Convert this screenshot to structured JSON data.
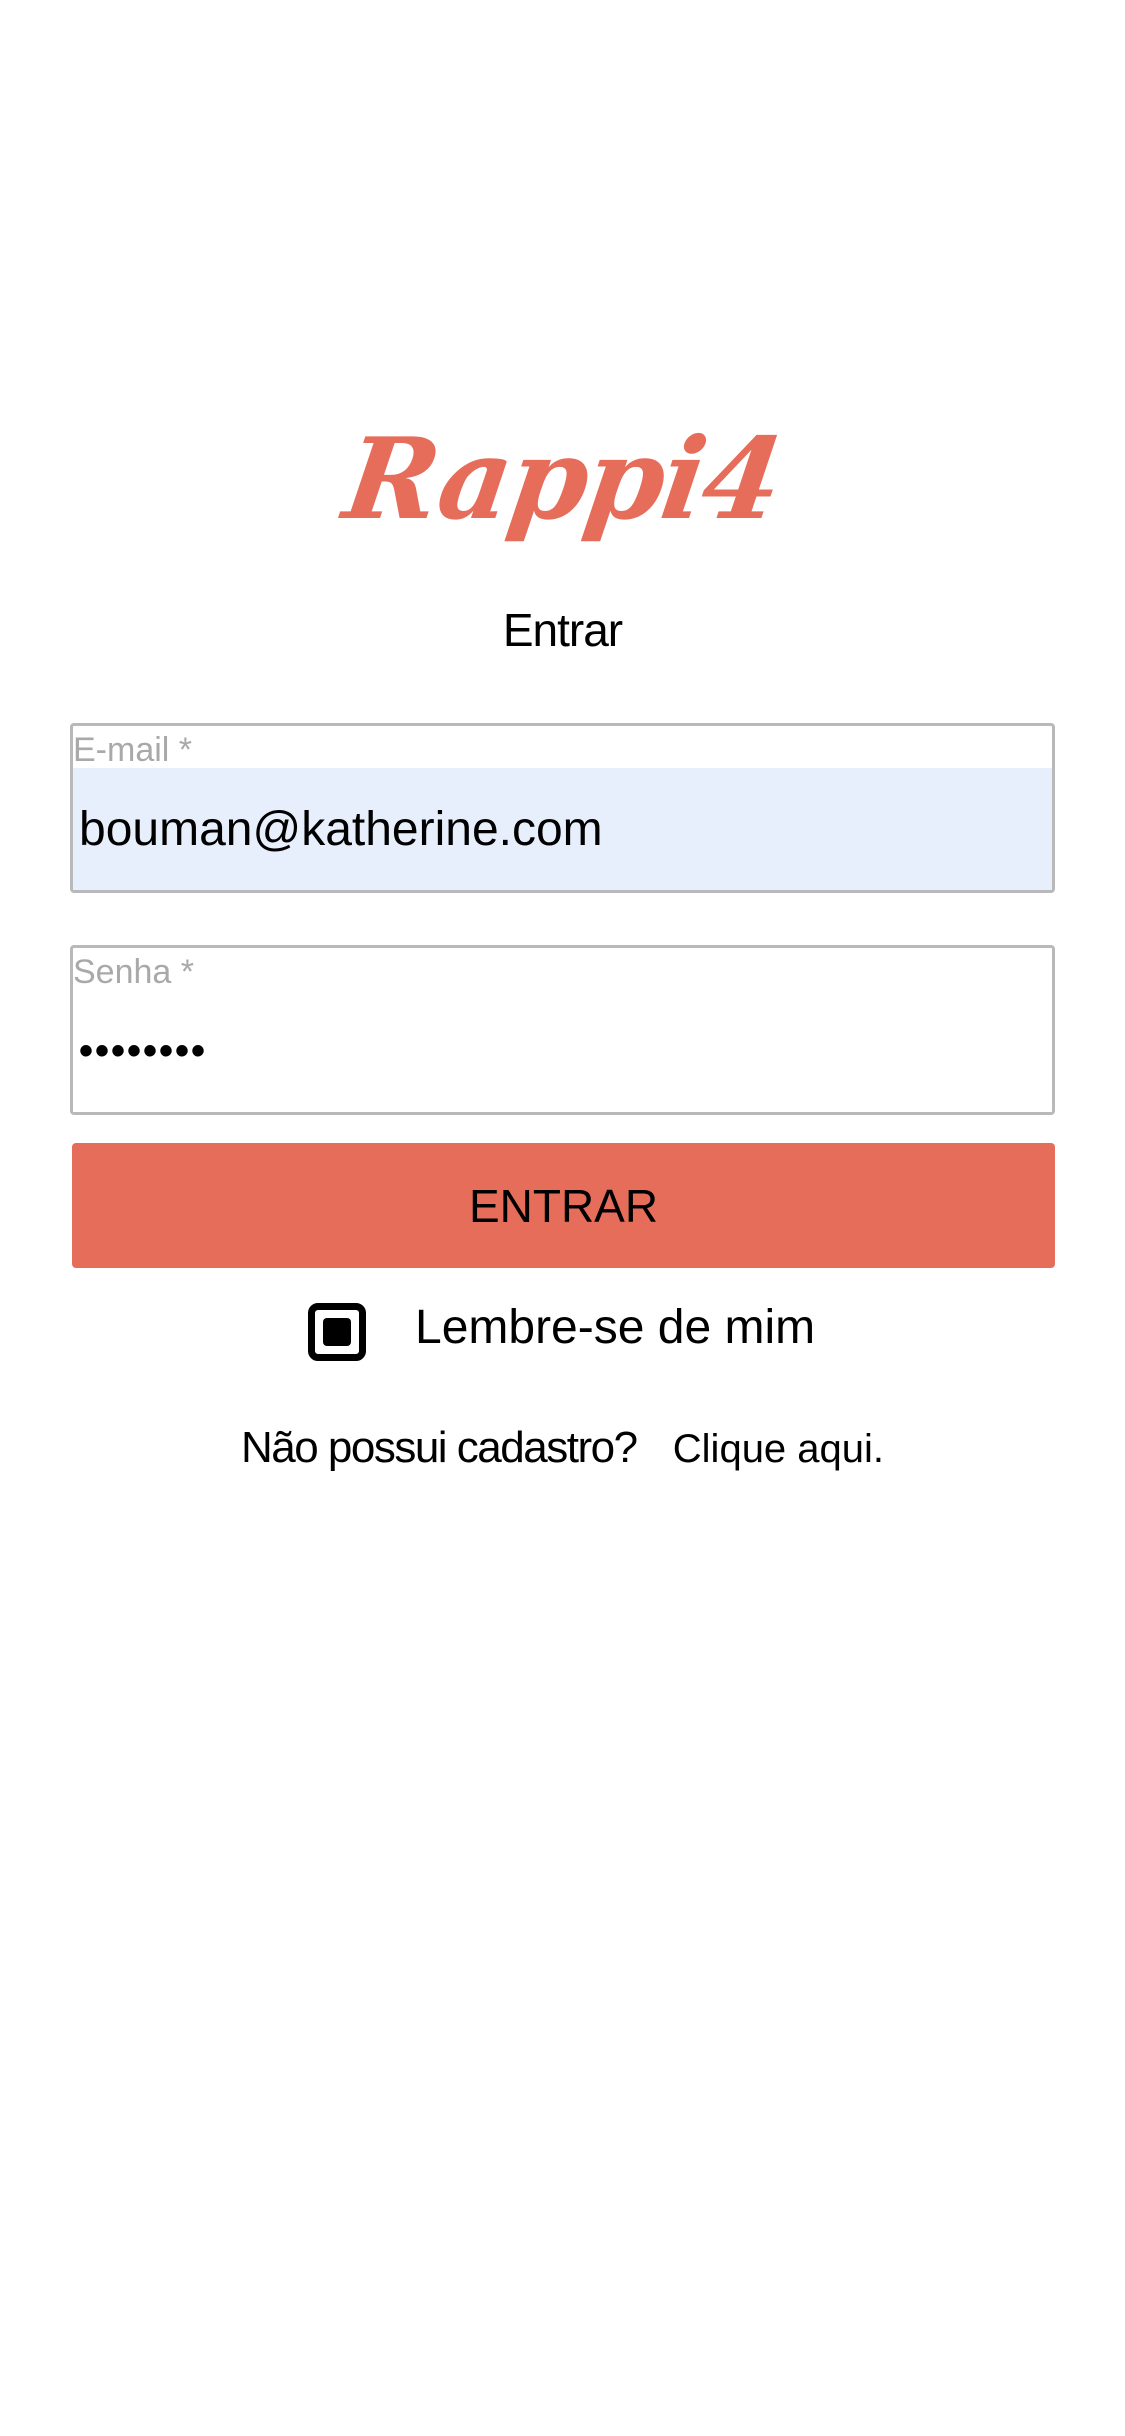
{
  "logo": {
    "text": "Rappi4"
  },
  "page": {
    "title": "Entrar"
  },
  "form": {
    "email": {
      "label": "E-mail *",
      "value": "bouman@katherine.com"
    },
    "password": {
      "label": "Senha *",
      "value": "••••••••"
    },
    "submit_label": "ENTRAR",
    "remember": {
      "label": "Lembre-se de mim",
      "checked": true
    }
  },
  "signup": {
    "question": "Não possui cadastro?",
    "link": "Clique aqui."
  },
  "colors": {
    "accent": "#e76d5b",
    "autofill_bg": "#e8effc",
    "field_border": "#b9b9b9",
    "label_gray": "#a9a9a9"
  },
  "icons": {
    "checkbox": "checkbox-checked-icon"
  }
}
